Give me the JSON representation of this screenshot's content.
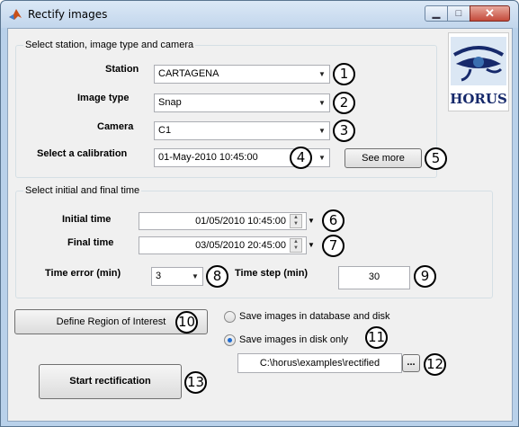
{
  "window": {
    "title": "Rectify images",
    "controls": {
      "minimize": "▁",
      "maximize": "□",
      "close": "✕"
    }
  },
  "logo": {
    "text": "HORUS",
    "colors": {
      "primary": "#16296b",
      "accent": "#3a6fb0"
    }
  },
  "group1": {
    "label": "Select station, image type and camera",
    "station": {
      "label": "Station",
      "value": "CARTAGENA"
    },
    "image_type": {
      "label": "Image type",
      "value": "Snap"
    },
    "camera": {
      "label": "Camera",
      "value": "C1"
    },
    "calibration": {
      "label": "Select a calibration",
      "value": "01-May-2010 10:45:00"
    },
    "see_more": "See more"
  },
  "group2": {
    "label": "Select initial and final time",
    "initial_time": {
      "label": "Initial time",
      "value": "01/05/2010 10:45:00"
    },
    "final_time": {
      "label": "Final time",
      "value": "03/05/2010 20:45:00"
    },
    "time_error": {
      "label": "Time error (min)",
      "value": "3"
    },
    "time_step": {
      "label": "Time step (min)",
      "value": "30"
    }
  },
  "define_roi": "Define Region of Interest",
  "save_options": [
    {
      "label": "Save images in database and disk",
      "selected": false
    },
    {
      "label": "Save images in disk only",
      "selected": true
    }
  ],
  "output_path": "C:\\horus\\examples\\rectified",
  "browse": "...",
  "start": "Start rectification",
  "markers": [
    "1",
    "2",
    "3",
    "4",
    "5",
    "6",
    "7",
    "8",
    "9",
    "10",
    "11",
    "12",
    "13"
  ],
  "icons": {
    "dropdown": "dropdown-arrow-icon",
    "spin": "spin-icon",
    "app": "matlab-icon"
  }
}
